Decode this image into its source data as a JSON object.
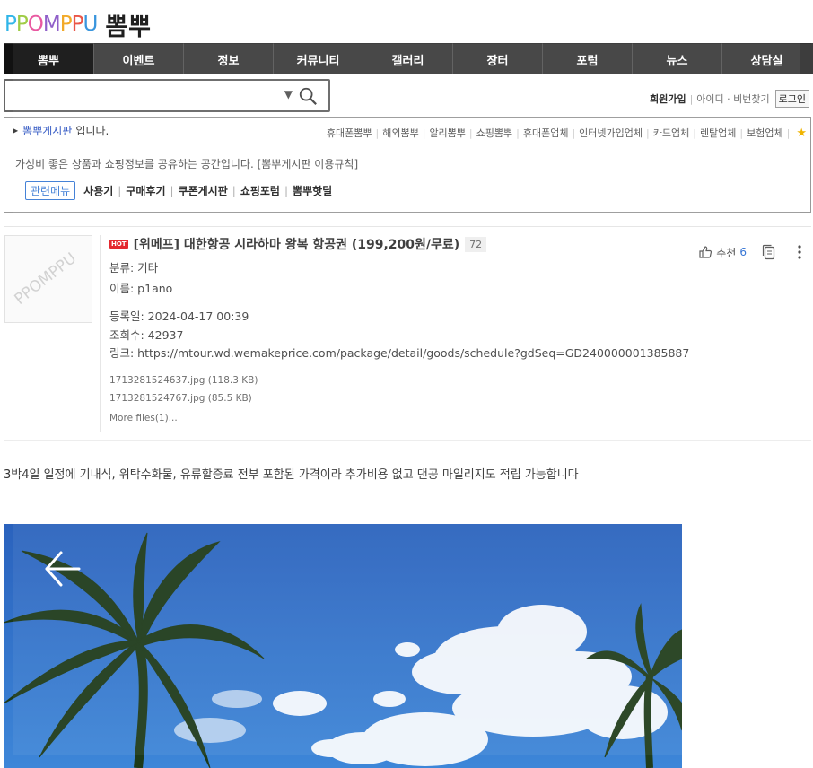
{
  "logo": {
    "letters": [
      {
        "ch": "P",
        "color": "#2fb5e8"
      },
      {
        "ch": "P",
        "color": "#9ac93a"
      },
      {
        "ch": "O",
        "color": "#e84f9c"
      },
      {
        "ch": "M",
        "color": "#8a57c6"
      },
      {
        "ch": "P",
        "color": "#f2a51c"
      },
      {
        "ch": "P",
        "color": "#e94b3c"
      },
      {
        "ch": "U",
        "color": "#2d8fdb"
      }
    ],
    "kr_name": "뽐뿌"
  },
  "nav": {
    "items": [
      "뽐뿌",
      "이벤트",
      "정보",
      "커뮤니티",
      "갤러리",
      "장터",
      "포럼",
      "뉴스",
      "상담실"
    ]
  },
  "search": {
    "placeholder": "",
    "dropdown_icon": "caret-down-icon",
    "search_icon": "search-icon"
  },
  "member": {
    "join": "회원가입",
    "find": "아이디 · 비번찾기",
    "login": "로그인"
  },
  "board": {
    "name": "뽐뿌게시판",
    "suffix": "입니다.",
    "partners": [
      "휴대폰뽐뿌",
      "해외뽐뿌",
      "알리뽐뿌",
      "쇼핑뽐뿌",
      "휴대폰업체",
      "인터넷가입업체",
      "카드업체",
      "렌탈업체",
      "보험업체"
    ],
    "star_icon": "favorite-star-icon",
    "description": "가성비 좋은 상품과 쇼핑정보를 공유하는 공간입니다. [뽐뿌게시판 이용규칙]",
    "related_label": "관련메뉴",
    "related_links": [
      "사용기",
      "구매후기",
      "쿠폰게시판",
      "쇼핑포럼",
      "뽐뿌핫딜"
    ]
  },
  "post": {
    "hot_badge": "HOT",
    "title": "[위메프] 대한항공 시라하마 왕복 항공권 (199,200원/무료)",
    "comment_count": "72",
    "category": "분류: 기타",
    "author": "이름: p1ano",
    "date": "등록일: 2024-04-17 00:39",
    "views": "조회수: 42937",
    "link": "링크: https://mtour.wd.wemakeprice.com/package/detail/goods/schedule?gdSeq=GD240000001385887",
    "files": [
      "1713281524637.jpg (118.3 KB)",
      "1713281524767.jpg (85.5 KB)"
    ],
    "more_files": "More files(1)...",
    "recommend_label": "추천",
    "recommend_count": "6",
    "thumb_word": "PPOMPPU"
  },
  "content": {
    "text": "3박4일 일정에 기내식, 위탁수화물, 유류할증료 전부 포함된 가격이라 추가비용 없고 댄공 마일리지도 적립 가능합니다"
  },
  "colors": {
    "nav_bg": "#3d3d3d",
    "nav_active": "#111111",
    "board_link": "#2b52c2",
    "hot": "#e31c23",
    "sky": "#2f6fc7"
  }
}
